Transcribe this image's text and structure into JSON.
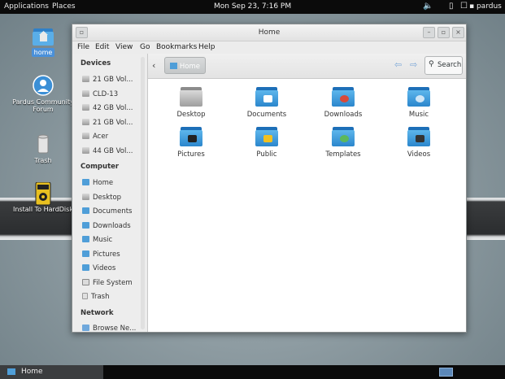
{
  "top_panel": {
    "applications": "Applications",
    "places": "Places",
    "clock": "Mon Sep 23,  7:16 PM",
    "user": "pardus"
  },
  "desktop": {
    "icons": [
      {
        "label": "home",
        "icon": "home-folder-icon"
      },
      {
        "label": "Pardus Community Forum",
        "icon": "globe-person-icon"
      },
      {
        "label": "Trash",
        "icon": "trash-icon"
      },
      {
        "label": "Install To HardDisk",
        "icon": "installer-icon"
      }
    ]
  },
  "window": {
    "title": "Home",
    "menu": [
      "File",
      "Edit",
      "View",
      "Go",
      "Bookmarks",
      "Help"
    ],
    "toolbar": {
      "path": "Home",
      "search_label": "Search"
    },
    "sidebar": {
      "devices_header": "Devices",
      "devices": [
        "21 GB Vol...",
        "CLD-13",
        "42 GB Vol...",
        "21 GB Vol...",
        "Acer",
        "44 GB Vol..."
      ],
      "computer_header": "Computer",
      "computer": [
        "Home",
        "Desktop",
        "Documents",
        "Downloads",
        "Music",
        "Pictures",
        "Videos",
        "File System",
        "Trash"
      ],
      "network_header": "Network",
      "network": [
        "Browse Ne..."
      ]
    },
    "files": [
      {
        "name": "Desktop",
        "icon": "desktop-folder-icon"
      },
      {
        "name": "Documents",
        "icon": "documents-folder-icon"
      },
      {
        "name": "Downloads",
        "icon": "downloads-folder-icon"
      },
      {
        "name": "Music",
        "icon": "music-folder-icon"
      },
      {
        "name": "Pictures",
        "icon": "pictures-folder-icon"
      },
      {
        "name": "Public",
        "icon": "public-folder-icon"
      },
      {
        "name": "Templates",
        "icon": "templates-folder-icon"
      },
      {
        "name": "Videos",
        "icon": "videos-folder-icon"
      }
    ]
  },
  "bottom_panel": {
    "task": "Home"
  }
}
